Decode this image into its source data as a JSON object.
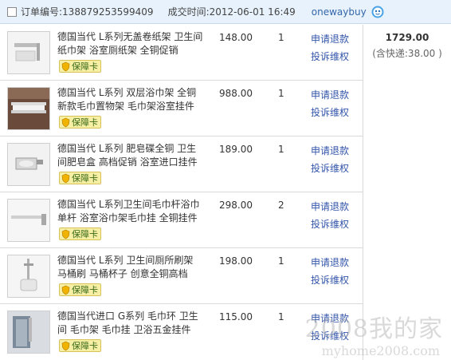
{
  "order": {
    "number_label": "订单编号:",
    "number": "138879253599409",
    "time_label": "成交时间:",
    "time": "2012-06-01 16:49",
    "seller": "onewaybuy",
    "total": "1729.00",
    "shipping": "(含快递:38.00 )"
  },
  "badge_label": "保障卡",
  "actions": {
    "refund": "申请退款",
    "complain": "投诉维权"
  },
  "items": [
    {
      "title": "德国当代 L系列无盖卷纸架 卫生间纸巾架 浴室厕纸架 全铜促销",
      "price": "148.00",
      "qty": "1"
    },
    {
      "title": "德国当代 L系列 双层浴巾架 全铜新款毛巾置物架 毛巾架浴室挂件",
      "price": "988.00",
      "qty": "1"
    },
    {
      "title": "德国当代 L系列 肥皂碟全铜 卫生间肥皂盒 高档促销 浴室进口挂件",
      "price": "189.00",
      "qty": "1"
    },
    {
      "title": "德国当代 L系列卫生间毛巾杆浴巾单杆 浴室浴巾架毛巾挂 全铜挂件",
      "price": "298.00",
      "qty": "2"
    },
    {
      "title": "德国当代 L系列 卫生间厕所刷架 马桶刷 马桶杯子 创意全铜高档",
      "price": "198.00",
      "qty": "1"
    },
    {
      "title": "德国当代进口 G系列 毛巾环 卫生间 毛巾架 毛巾挂 卫浴五金挂件",
      "price": "115.00",
      "qty": "1"
    }
  ],
  "watermark": {
    "text": "2008我的家",
    "url": "myhome2008.com"
  }
}
